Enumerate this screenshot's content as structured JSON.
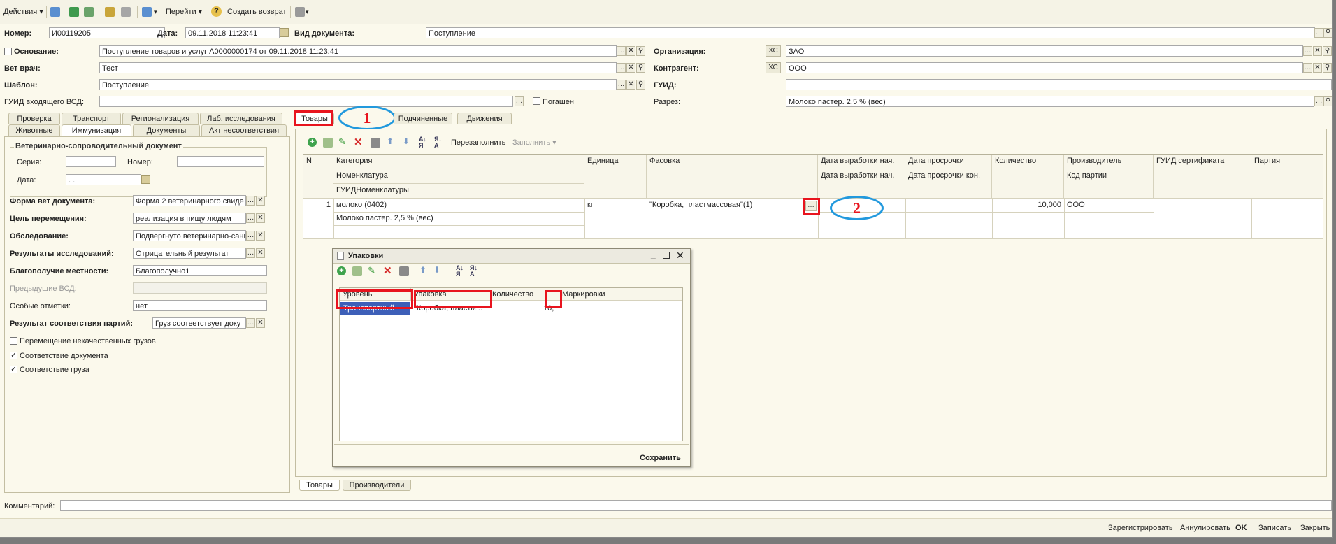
{
  "toolbar": {
    "actions": "Действия",
    "goto": "Перейти",
    "help": "?",
    "create_return": "Создать возврат"
  },
  "header": {
    "number_label": "Номер:",
    "number_value": "И00119205",
    "date_label": "Дата:",
    "date_value": "09.11.2018 11:23:41",
    "doctype_label": "Вид документа:",
    "doctype_value": "Поступление",
    "basis_label": "Основание:",
    "basis_value": "Поступление товаров и услуг А0000000174 от 09.11.2018 11:23:41",
    "org_label": "Организация:",
    "org_xs": "ХС",
    "org_value": "ЗАО",
    "vet_label": "Вет врач:",
    "vet_value": "Тест",
    "contractor_label": "Контрагент:",
    "contractor_xs": "ХС",
    "contractor_value": "ООО",
    "template_label": "Шаблон:",
    "template_value": "Поступление",
    "guid_label": "ГУИД:",
    "guid_value": "",
    "incoming_guid_label": "ГУИД входящего ВСД:",
    "incoming_guid_value": "",
    "repaid_label": "Погашен",
    "razrez_label": "Разрез:",
    "razrez_value": "Молоко пастер. 2,5 % (вес)"
  },
  "left_tabs": {
    "row1": [
      "Проверка",
      "Транспорт",
      "Регионализация",
      "Лаб. исследования"
    ],
    "row2": [
      "Животные",
      "Иммунизация",
      "Документы",
      "Акт несоответствия"
    ]
  },
  "vsd": {
    "group_title": "Ветеринарно-сопроводительный документ",
    "series_label": "Серия:",
    "series_value": "",
    "number_label": "Номер:",
    "number_value": "",
    "date_label": "Дата:",
    "date_value": " .  .",
    "form_label": "Форма вет документа:",
    "form_value": "Форма 2 ветеринарного свиде",
    "purpose_label": "Цель перемещения:",
    "purpose_value": "реализация в пищу людям",
    "inspection_label": "Обследование:",
    "inspection_value": "Подвергнуто ветеринарно-сани",
    "results_label": "Результаты исследований:",
    "results_value": "Отрицательный результат",
    "wellbeing_label": "Благополучие местности:",
    "wellbeing_value": "Благополучно1",
    "prev_vsd_label": "Предыдущие ВСД:",
    "prev_vsd_value": "",
    "notes_label": "Особые отметки:",
    "notes_value": "нет",
    "batch_result_label": "Результат соответствия партий:",
    "batch_result_value": "Груз соответствует доку",
    "bad_goods_label": "Перемещение некачественных грузов",
    "doc_match_label": "Соответствие документа",
    "cargo_match_label": "Соответствие груза"
  },
  "right_tabs": [
    "Товары",
    "Подчиненные",
    "Движения"
  ],
  "goods_toolbar": {
    "refill": "Перезаполнить",
    "fill": "Заполнить"
  },
  "goods_table": {
    "headers": {
      "n": "N",
      "category": "Категория",
      "nomenclature": "Номенклатура",
      "guid_nom": "ГУИДНоменклатуры",
      "unit": "Единица",
      "packing": "Фасовка",
      "prod_start": "Дата выработки нач.",
      "prod_start2": "Дата выработки нач.",
      "expiry": "Дата просрочки",
      "expiry_end": "Дата просрочки кон.",
      "qty": "Количество",
      "producer": "Производитель",
      "batch_code": "Код партии",
      "cert_guid": "ГУИД сертификата",
      "batch": "Партия"
    },
    "row": {
      "n": "1",
      "category": "молоко (0402)",
      "nomenclature": "Молоко пастер. 2,5 % (вес)",
      "unit": "кг",
      "packing": "\"Коробка, пластмассовая\"(1)",
      "qty": "10,000",
      "producer": "ООО"
    }
  },
  "bottom_tabs": [
    "Товары",
    "Производители"
  ],
  "annotations": [
    "1",
    "2"
  ],
  "dialog": {
    "title": "Упаковки",
    "headers": [
      "Уровень",
      "Упаковка",
      "Количество",
      "Маркировки"
    ],
    "row": {
      "level": "Транспортный",
      "pack": "\"Коробка, пластм...",
      "qty": "10,"
    },
    "save": "Сохранить"
  },
  "comment_label": "Комментарий:",
  "comment_value": "",
  "status": {
    "register": "Зарегистрировать",
    "annul": "Аннулировать",
    "ok": "OK",
    "write": "Записать",
    "close": "Закрыть"
  },
  "colors": {
    "annotation_red": "#e8141e",
    "annotation_blue": "#2299dd",
    "selected_row": "#3d5fb8"
  }
}
